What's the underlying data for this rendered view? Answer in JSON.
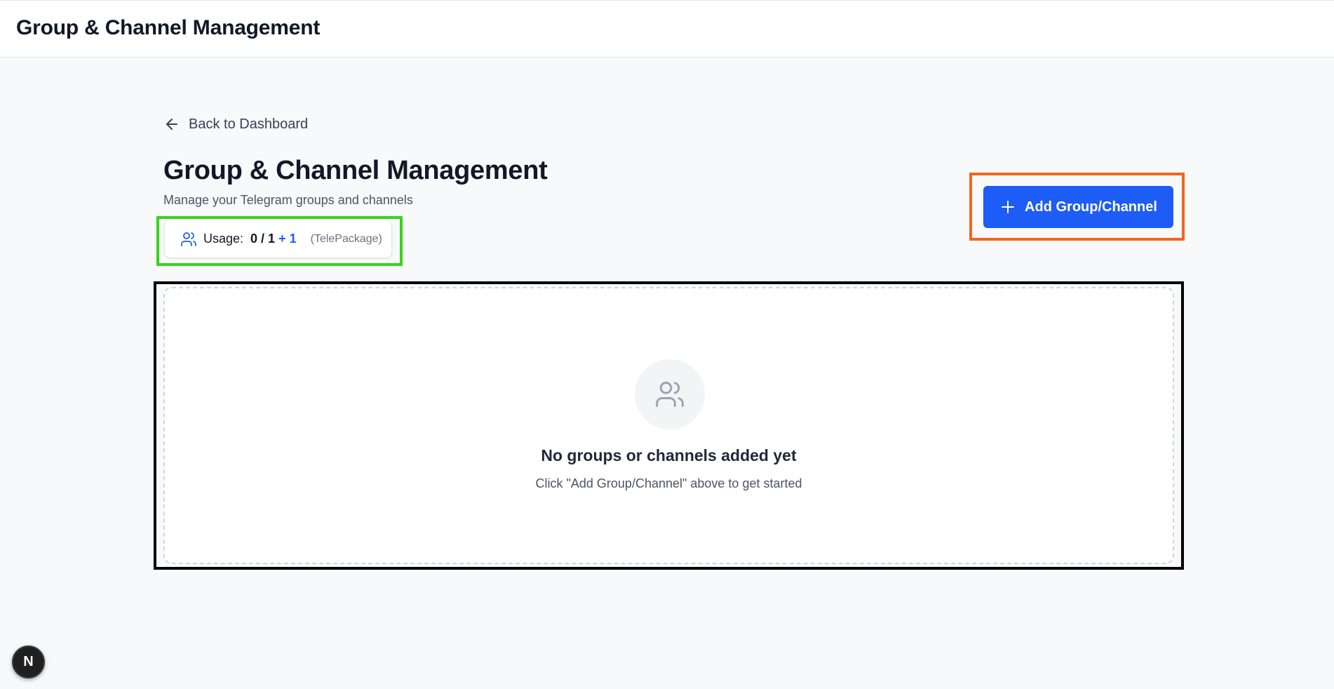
{
  "header": {
    "title": "Group & Channel Management"
  },
  "nav": {
    "back_label": "Back to Dashboard"
  },
  "page": {
    "title": "Group & Channel Management",
    "subtitle": "Manage your Telegram groups and channels"
  },
  "usage": {
    "label": "Usage:",
    "value": "0 / 1",
    "bonus": "+ 1",
    "package": "(TelePackage)"
  },
  "actions": {
    "add_label": "Add Group/Channel"
  },
  "empty_state": {
    "title": "No groups or channels added yet",
    "hint": "Click \"Add Group/Channel\" above to get started"
  },
  "badge": {
    "letter": "N"
  },
  "colors": {
    "primary": "#1d5cf5",
    "usage_highlight": "#39d41a",
    "action_highlight": "#f2661c",
    "list_highlight": "#000000"
  },
  "icons": {
    "back": "arrow-left-icon",
    "usage": "users-icon",
    "add": "plus-icon",
    "empty": "users-icon"
  }
}
